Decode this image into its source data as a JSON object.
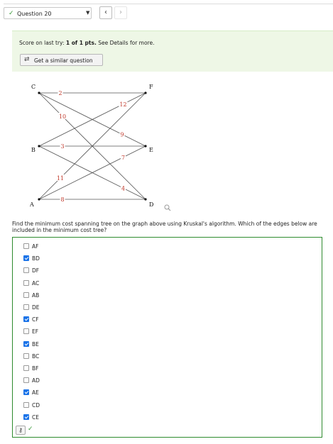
{
  "header": {
    "question_select": "Question 20",
    "prev_label": "‹",
    "next_label": "›"
  },
  "score": {
    "prefix": "Score on last try: ",
    "value": "1 of 1",
    "middle": " pts.",
    "suffix": " See Details for more."
  },
  "similar_button": {
    "label": "Get a similar question"
  },
  "graph": {
    "nodes": [
      {
        "id": "C",
        "label": "C"
      },
      {
        "id": "B",
        "label": "B"
      },
      {
        "id": "A",
        "label": "A"
      },
      {
        "id": "F",
        "label": "F"
      },
      {
        "id": "E",
        "label": "E"
      },
      {
        "id": "D",
        "label": "D"
      }
    ],
    "edges": [
      {
        "from": "C",
        "to": "F",
        "weight": "2"
      },
      {
        "from": "C",
        "to": "D",
        "weight": "10"
      },
      {
        "from": "C",
        "to": "E",
        "weight": "9"
      },
      {
        "from": "B",
        "to": "F",
        "weight": "12"
      },
      {
        "from": "B",
        "to": "E",
        "weight": "3"
      },
      {
        "from": "B",
        "to": "D",
        "weight": "4"
      },
      {
        "from": "A",
        "to": "F",
        "weight": "11"
      },
      {
        "from": "A",
        "to": "E",
        "weight": "7"
      },
      {
        "from": "A",
        "to": "D",
        "weight": "8"
      }
    ]
  },
  "problem": {
    "text": "Find the minimum cost spanning tree on the graph above using Kruskal's algorithm. Which of the edges below are included in the minimum cost tree?"
  },
  "options": [
    {
      "label": "AF",
      "checked": false
    },
    {
      "label": "BD",
      "checked": true
    },
    {
      "label": "DF",
      "checked": false
    },
    {
      "label": "AC",
      "checked": false
    },
    {
      "label": "AB",
      "checked": false
    },
    {
      "label": "DE",
      "checked": false
    },
    {
      "label": "CF",
      "checked": true
    },
    {
      "label": "EF",
      "checked": false
    },
    {
      "label": "BE",
      "checked": true
    },
    {
      "label": "BC",
      "checked": false
    },
    {
      "label": "BF",
      "checked": false
    },
    {
      "label": "AD",
      "checked": false
    },
    {
      "label": "AE",
      "checked": true
    },
    {
      "label": "CD",
      "checked": false
    },
    {
      "label": "CE",
      "checked": true
    }
  ],
  "colors": {
    "weight_label": "#c0392b",
    "edge": "#555555",
    "correct_border": "#2e8b2e",
    "checkbox_checked": "#1a73e8"
  }
}
